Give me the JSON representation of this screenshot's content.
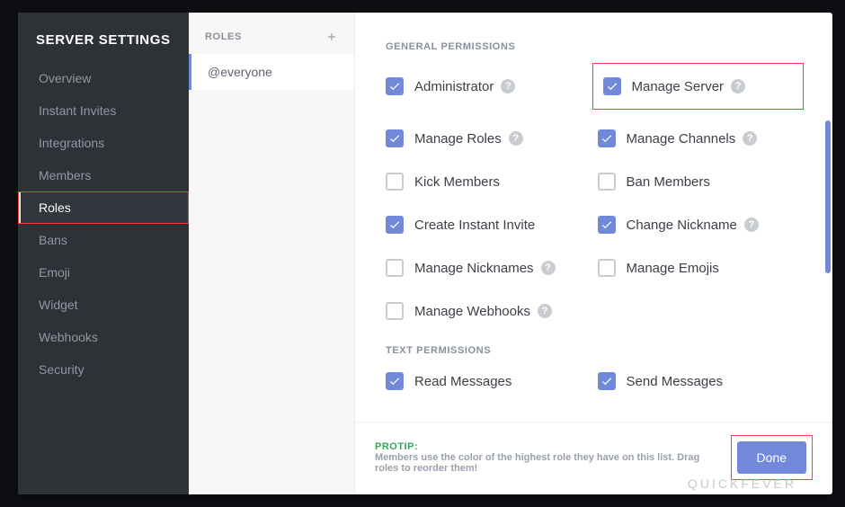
{
  "window": {
    "title": "SERVER SETTINGS"
  },
  "sidebar": {
    "items": [
      {
        "label": "Overview"
      },
      {
        "label": "Instant Invites"
      },
      {
        "label": "Integrations"
      },
      {
        "label": "Members"
      },
      {
        "label": "Roles",
        "active": true,
        "highlight": true
      },
      {
        "label": "Bans"
      },
      {
        "label": "Emoji"
      },
      {
        "label": "Widget"
      },
      {
        "label": "Webhooks"
      },
      {
        "label": "Security"
      }
    ]
  },
  "roles": {
    "header": "ROLES",
    "add_icon": "plus-icon",
    "items": [
      {
        "label": "@everyone",
        "active": true
      }
    ]
  },
  "permissions": {
    "sections": [
      {
        "title": "GENERAL PERMISSIONS",
        "items": [
          {
            "label": "Administrator",
            "checked": true,
            "help": true
          },
          {
            "label": "Manage Server",
            "checked": true,
            "help": true,
            "highlight": true
          },
          {
            "label": "Manage Roles",
            "checked": true,
            "help": true
          },
          {
            "label": "Manage Channels",
            "checked": true,
            "help": true
          },
          {
            "label": "Kick Members",
            "checked": false,
            "help": false
          },
          {
            "label": "Ban Members",
            "checked": false,
            "help": false
          },
          {
            "label": "Create Instant Invite",
            "checked": true,
            "help": false
          },
          {
            "label": "Change Nickname",
            "checked": true,
            "help": true
          },
          {
            "label": "Manage Nicknames",
            "checked": false,
            "help": true
          },
          {
            "label": "Manage Emojis",
            "checked": false,
            "help": false
          },
          {
            "label": "Manage Webhooks",
            "checked": false,
            "help": true
          }
        ]
      },
      {
        "title": "TEXT PERMISSIONS",
        "items": [
          {
            "label": "Read Messages",
            "checked": true,
            "help": false
          },
          {
            "label": "Send Messages",
            "checked": true,
            "help": false
          }
        ]
      }
    ]
  },
  "footer": {
    "protip_label": "PROTIP:",
    "protip_text": "Members use the color of the highest role they have on this list. Drag roles to reorder them!",
    "done_label": "Done"
  },
  "watermark": "QUICKFEVER",
  "colors": {
    "accent": "#7289da",
    "green": "#3ba55c",
    "highlight": "#ff3b3b"
  }
}
